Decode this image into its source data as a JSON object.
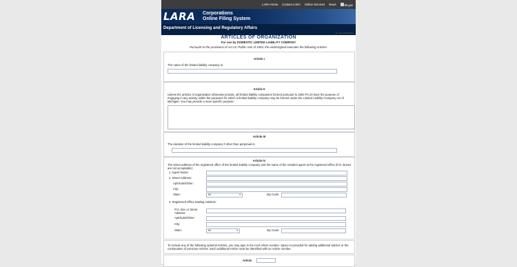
{
  "topnav": {
    "links": [
      "LARA Home",
      "Contact LARA",
      "Online Services",
      "News",
      "Mi.gov"
    ]
  },
  "banner": {
    "logo_text": "LARA",
    "system_line1": "Corporations",
    "system_line2": "Online Filing System",
    "department": "Department of Licensing and Regulatory Affairs",
    "version": "Ver Rev 02/29/2012"
  },
  "form": {
    "title": "ARTICLES OF ORGANIZATION",
    "subtitle": "For use by DOMESTIC LIMITED LIABILITY COMPANY",
    "intro": "Pursuant to the provisions of Act 23, Public Acts of 1993, the undersigned executes the following Articles:"
  },
  "article1": {
    "title": "Article I",
    "text": "The name of the limited liability company is:",
    "name_value": ""
  },
  "article2": {
    "title": "Article II",
    "text": "Unless the articles of organization otherwise provide, all limited liability companies formed pursuant to 1993 PA 23 have the purpose of engaging in any activity within the purposes for which a limited liability company may be formed under the Limited Liability Company Act of Michigan. You may provide a more specific purpose:"
  },
  "article3": {
    "title": "Article III",
    "text": "The duration of the limited liability company if other than perpetual is:"
  },
  "article4": {
    "title": "Article IV",
    "text": "The street address of the registered office of the limited liability company and the name of the resident agent at the registered office (P.O. Boxes are not acceptable):",
    "item1": "1.  Agent Name:",
    "item2": "2.  Street Address:",
    "apt": "Apt/Suite/Other:",
    "city": "City:",
    "state": "State:",
    "state_value": "MI",
    "zip": "Zip Code:",
    "item3": "3.  Registered Office Mailing Address:",
    "po_box_1": "P.O. Box or Street",
    "po_box_2": "Address:",
    "apt2": "Apt/Suite/Other:",
    "city2": "City:",
    "state2": "State:",
    "state2_value": "MI",
    "zip2": "Zip Code:"
  },
  "optional": {
    "text": "To include any of the following optional Articles, you may type in the next Article number. Space is provided for adding additional articles or the continuation of previous Articles. Each additional Article must be identified with an Article number.",
    "article_label": "Article"
  },
  "colors": {
    "banner": "#0b2b5b",
    "title": "#1b3f7a",
    "nav": "#3d3d3d"
  }
}
